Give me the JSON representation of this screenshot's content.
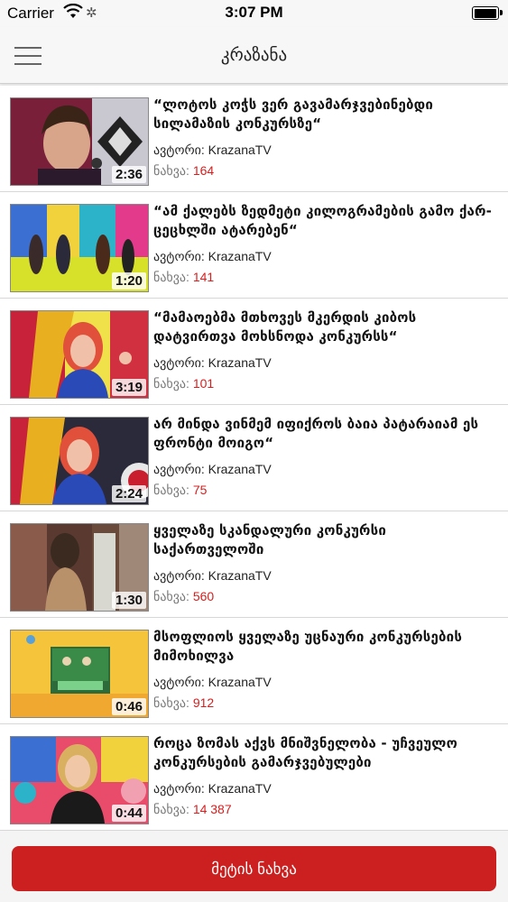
{
  "status_bar": {
    "carrier": "Carrier",
    "time": "3:07 PM"
  },
  "header": {
    "title": "კრაზანა",
    "menu_icon": "hamburger-menu-icon"
  },
  "videos": [
    {
      "title": "“ლოტოს კოჭს ვერ გავამარჯვებინებდი სილამაზის კონკურსზე“",
      "author_label": "ავტორი:",
      "author": "KrazanaTV",
      "views_label": "ნახვა:",
      "views": "164",
      "duration": "2:36"
    },
    {
      "title": "“ამ ქალებს ზედმეტი კილოგრამების გამო ქარ-ცეცხლში ატარებენ“",
      "author_label": "ავტორი:",
      "author": "KrazanaTV",
      "views_label": "ნახვა:",
      "views": "141",
      "duration": "1:20"
    },
    {
      "title": "“მამაოებმა მთხოვეს მკერდის კიბოს დატვირთვა მოხსნოდა კონკურსს“",
      "author_label": "ავტორი:",
      "author": "KrazanaTV",
      "views_label": "ნახვა:",
      "views": "101",
      "duration": "3:19"
    },
    {
      "title": "არ მინდა ვინმემ იფიქროს ბაია პატარაიამ ეს ფრონტი მოიგო“",
      "author_label": "ავტორი:",
      "author": "KrazanaTV",
      "views_label": "ნახვა:",
      "views": "75",
      "duration": "2:24"
    },
    {
      "title": "ყველაზე სკანდალური კონკურსი საქართველოში",
      "author_label": "ავტორი:",
      "author": "KrazanaTV",
      "views_label": "ნახვა:",
      "views": "560",
      "duration": "1:30"
    },
    {
      "title": "მსოფლიოს ყველაზე უცნაური კონკურსების მიმოხილვა",
      "author_label": "ავტორი:",
      "author": "KrazanaTV",
      "views_label": "ნახვა:",
      "views": "912",
      "duration": "0:46"
    },
    {
      "title": "როცა ზომას აქვს მნიშვნელობა - უჩვეულო კონკურსების გამარჯვებულები",
      "author_label": "ავტორი:",
      "author": "KrazanaTV",
      "views_label": "ნახვა:",
      "views": "14 387",
      "duration": "0:44"
    }
  ],
  "footer": {
    "more_label": "მეტის ნახვა"
  },
  "colors": {
    "accent": "#cc1f1f",
    "view_count": "#d42020"
  }
}
